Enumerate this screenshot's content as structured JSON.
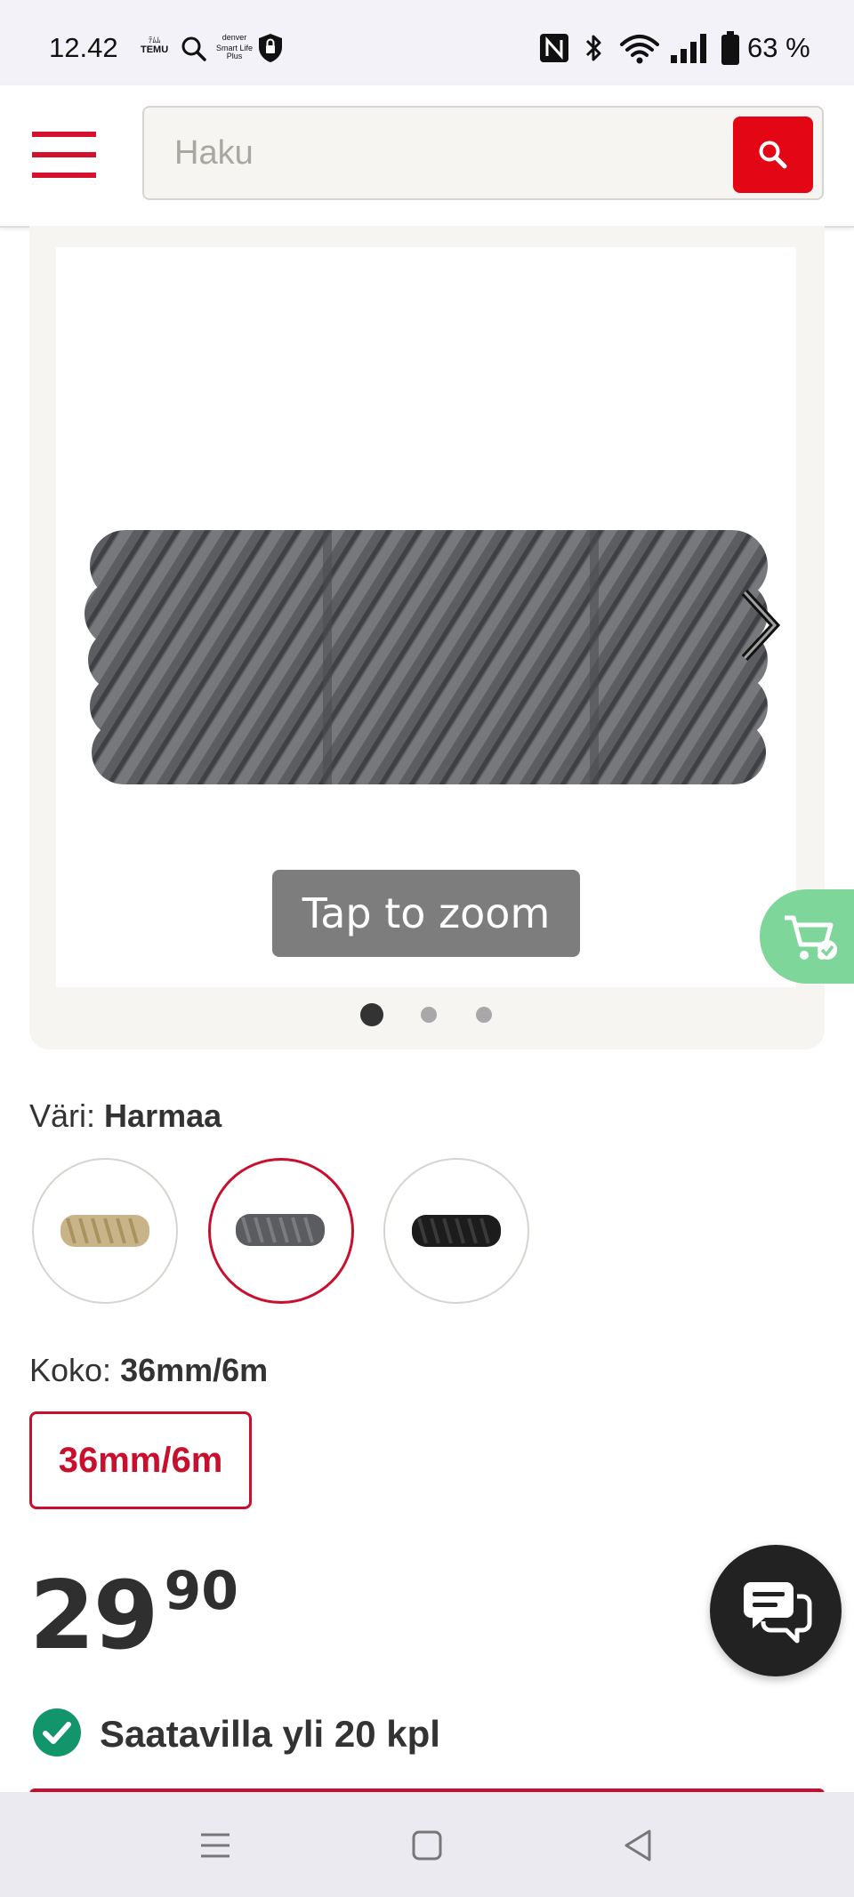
{
  "status_bar": {
    "time": "12.42",
    "temu_top": "ﾃﾑﾑ",
    "temu_label": "TEMU",
    "denver_label": "denver",
    "smart_life_line1": "Smart Life",
    "smart_life_line2": "Plus",
    "battery_percent": "63 %",
    "icons": [
      "temu-icon",
      "search-icon",
      "denver-smart-life-icon",
      "shield-icon",
      "nfc-icon",
      "bluetooth-icon",
      "wifi-icon",
      "signal-icon",
      "battery-icon"
    ]
  },
  "header": {
    "search_placeholder": "Haku",
    "search_value": "",
    "icons": [
      "menu-icon",
      "search-icon"
    ]
  },
  "gallery": {
    "zoom_hint": "Tap to zoom",
    "image_count": 3,
    "active_index": 0,
    "icons": [
      "chevron-right-icon"
    ]
  },
  "variants": {
    "color_label": "Väri:",
    "color_value": "Harmaa",
    "swatches": [
      {
        "color": "#c9b48a",
        "selected": false
      },
      {
        "color": "#5b5c60",
        "selected": true
      },
      {
        "color": "#1c1c1c",
        "selected": false
      }
    ],
    "size_label": "Koko:",
    "size_value": "36mm/6m",
    "size_options": [
      "36mm/6m"
    ]
  },
  "price": {
    "integer": "29",
    "decimals": "90"
  },
  "availability": {
    "text": "Saatavilla yli 20 kpl",
    "icon": "check-circle-icon",
    "color": "#13956b"
  },
  "colors": {
    "brand_red": "#e30614",
    "accent_red": "#c8102e",
    "cart_green": "#7fd69a"
  },
  "nav": {
    "icons": [
      "recent-apps-icon",
      "home-icon",
      "back-icon"
    ]
  }
}
